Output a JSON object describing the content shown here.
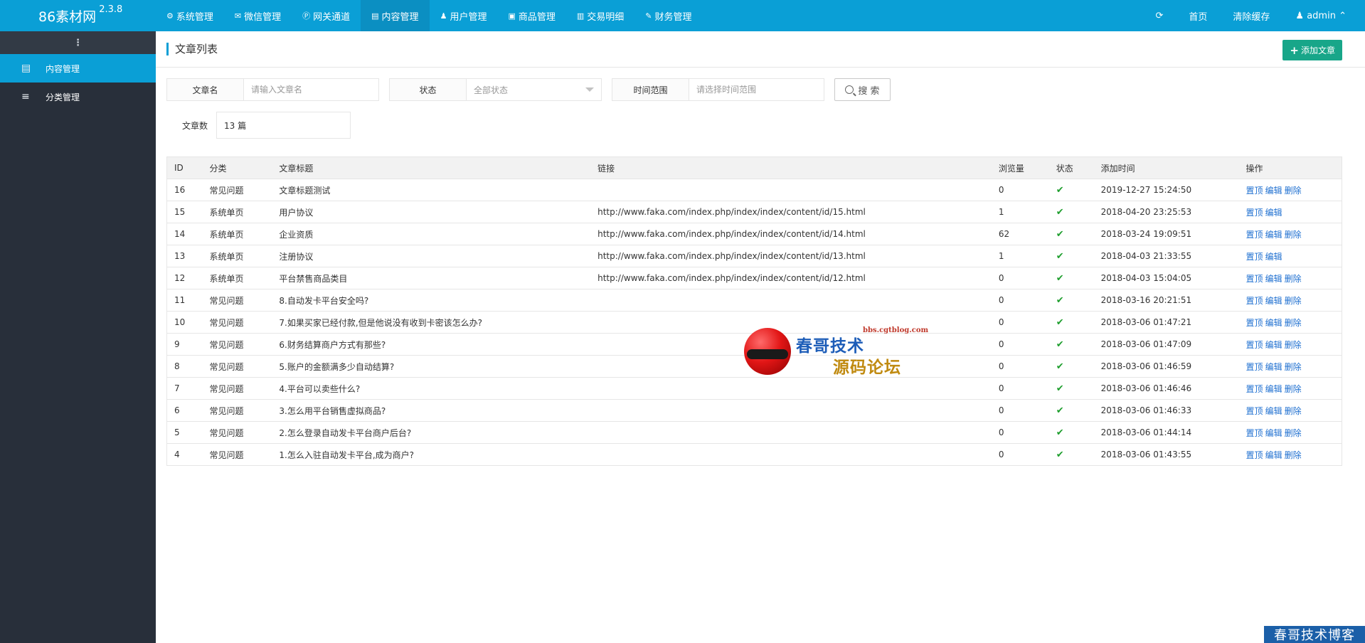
{
  "brand": {
    "name": "86素材网",
    "version": "2.3.8"
  },
  "topnav": [
    {
      "icon": "gear-icon",
      "glyph": "⚙",
      "label": "系统管理"
    },
    {
      "icon": "wechat-icon",
      "glyph": "✉",
      "label": "微信管理"
    },
    {
      "icon": "gateway-icon",
      "glyph": "Ⓟ",
      "label": "网关通道"
    },
    {
      "icon": "document-icon",
      "glyph": "▤",
      "label": "内容管理",
      "active": true
    },
    {
      "icon": "users-icon",
      "glyph": "♟",
      "label": "用户管理"
    },
    {
      "icon": "bag-icon",
      "glyph": "▣",
      "label": "商品管理"
    },
    {
      "icon": "bar-chart-icon",
      "glyph": "▥",
      "label": "交易明细"
    },
    {
      "icon": "finance-icon",
      "glyph": "✎",
      "label": "财务管理"
    }
  ],
  "topright": {
    "refresh_glyph": "⟳",
    "home": "首页",
    "clear_cache": "清除缓存",
    "user": "admin"
  },
  "sidebar": {
    "toggle": "⋮",
    "items": [
      {
        "icon": "document-icon",
        "glyph": "▤",
        "label": "内容管理",
        "active": true
      },
      {
        "icon": "list-icon",
        "glyph": "≡",
        "label": "分类管理"
      }
    ]
  },
  "page": {
    "title": "文章列表",
    "add_button": "添加文章"
  },
  "filters": {
    "name_label": "文章名",
    "name_placeholder": "请输入文章名",
    "status_label": "状态",
    "status_value": "全部状态",
    "time_label": "时间范围",
    "time_placeholder": "请选择时间范围",
    "search_button": "搜 索"
  },
  "count": {
    "label": "文章数",
    "value": "13 篇"
  },
  "table": {
    "headers": [
      "ID",
      "分类",
      "文章标题",
      "链接",
      "浏览量",
      "状态",
      "添加时间",
      "操作"
    ],
    "rows": [
      {
        "id": "16",
        "cat": "常见问题",
        "title": "文章标题测试",
        "link": "",
        "views": "0",
        "time": "2019-12-27 15:24:50",
        "ops": [
          "置顶",
          "编辑",
          "删除"
        ]
      },
      {
        "id": "15",
        "cat": "系统单页",
        "title": "用户协议",
        "link": "http://www.faka.com/index.php/index/index/content/id/15.html",
        "views": "1",
        "time": "2018-04-20 23:25:53",
        "ops": [
          "置顶",
          "编辑"
        ]
      },
      {
        "id": "14",
        "cat": "系统单页",
        "title": "企业资质",
        "link": "http://www.faka.com/index.php/index/index/content/id/14.html",
        "views": "62",
        "time": "2018-03-24 19:09:51",
        "ops": [
          "置顶",
          "编辑",
          "删除"
        ]
      },
      {
        "id": "13",
        "cat": "系统单页",
        "title": "注册协议",
        "link": "http://www.faka.com/index.php/index/index/content/id/13.html",
        "views": "1",
        "time": "2018-04-03 21:33:55",
        "ops": [
          "置顶",
          "编辑"
        ]
      },
      {
        "id": "12",
        "cat": "系统单页",
        "title": "平台禁售商品类目",
        "link": "http://www.faka.com/index.php/index/index/content/id/12.html",
        "views": "0",
        "time": "2018-04-03 15:04:05",
        "ops": [
          "置顶",
          "编辑",
          "删除"
        ]
      },
      {
        "id": "11",
        "cat": "常见问题",
        "title": "8.自动发卡平台安全吗?",
        "link": "",
        "views": "0",
        "time": "2018-03-16 20:21:51",
        "ops": [
          "置顶",
          "编辑",
          "删除"
        ]
      },
      {
        "id": "10",
        "cat": "常见问题",
        "title": "7.如果买家已经付款,但是他说没有收到卡密该怎么办?",
        "link": "",
        "views": "0",
        "time": "2018-03-06 01:47:21",
        "ops": [
          "置顶",
          "编辑",
          "删除"
        ]
      },
      {
        "id": "9",
        "cat": "常见问题",
        "title": "6.财务结算商户方式有那些?",
        "link": "",
        "views": "0",
        "time": "2018-03-06 01:47:09",
        "ops": [
          "置顶",
          "编辑",
          "删除"
        ]
      },
      {
        "id": "8",
        "cat": "常见问题",
        "title": "5.账户的金额满多少自动结算?",
        "link": "",
        "views": "0",
        "time": "2018-03-06 01:46:59",
        "ops": [
          "置顶",
          "编辑",
          "删除"
        ]
      },
      {
        "id": "7",
        "cat": "常见问题",
        "title": "4.平台可以卖些什么?",
        "link": "",
        "views": "0",
        "time": "2018-03-06 01:46:46",
        "ops": [
          "置顶",
          "编辑",
          "删除"
        ]
      },
      {
        "id": "6",
        "cat": "常见问题",
        "title": "3.怎么用平台销售虚拟商品?",
        "link": "",
        "views": "0",
        "time": "2018-03-06 01:46:33",
        "ops": [
          "置顶",
          "编辑",
          "删除"
        ]
      },
      {
        "id": "5",
        "cat": "常见问题",
        "title": "2.怎么登录自动发卡平台商户后台?",
        "link": "",
        "views": "0",
        "time": "2018-03-06 01:44:14",
        "ops": [
          "置顶",
          "编辑",
          "删除"
        ]
      },
      {
        "id": "4",
        "cat": "常见问题",
        "title": "1.怎么入驻自动发卡平台,成为商户?",
        "link": "",
        "views": "0",
        "time": "2018-03-06 01:43:55",
        "ops": [
          "置顶",
          "编辑",
          "删除"
        ]
      }
    ]
  },
  "watermark": {
    "line1": "春哥技术",
    "url": "bbs.cgtblog.com",
    "line2": "源码论坛",
    "corner": "春哥技术博客"
  },
  "colors": {
    "primary": "#0a9fd6",
    "sidebar": "#282f3a",
    "add_button": "#18a689",
    "link": "#1e6fd0",
    "check": "#1e9e2d"
  }
}
